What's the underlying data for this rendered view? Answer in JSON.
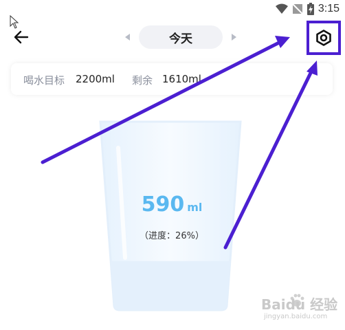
{
  "status_bar": {
    "time": "3:15"
  },
  "header": {
    "date_label": "今天"
  },
  "goal_card": {
    "goal_label": "喝水目标",
    "goal_value": "2200ml",
    "remaining_label": "剩余",
    "remaining_value": "1610ml"
  },
  "cup": {
    "amount": "590",
    "unit": "ml",
    "progress_text": "（进度：26%）",
    "progress_fraction": 0.26
  },
  "colors": {
    "accent_blue": "#5ab8f0",
    "highlight_purple": "#4b1fd1",
    "pill_bg": "#f1f2f6"
  },
  "watermark": {
    "text": "Baidu 经验",
    "sub": "jingyan.baidu.com"
  }
}
